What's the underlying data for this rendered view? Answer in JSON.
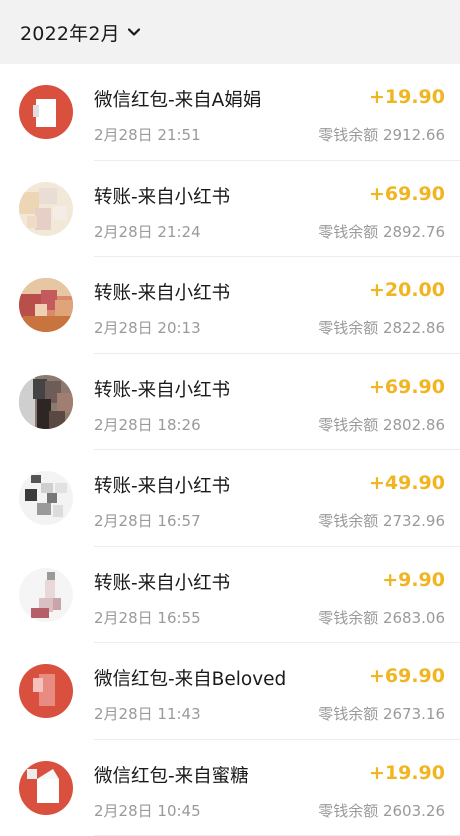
{
  "header": {
    "month": "2022年2月",
    "chevron_icon": "chevron-down-icon"
  },
  "colors": {
    "amount": "#f0b520",
    "secondary_text": "#9a9a9a",
    "background": "#f2f2f2"
  },
  "transactions": [
    {
      "title": "微信红包-来自A娟娟",
      "time": "2月28日 21:51",
      "amount": "+19.90",
      "balance": "零钱余额 2912.66",
      "avatar": "red-packet-avatar"
    },
    {
      "title": "转账-来自小红书",
      "time": "2月28日 21:24",
      "amount": "+69.90",
      "balance": "零钱余额 2892.76",
      "avatar": "blurred-user-avatar"
    },
    {
      "title": "转账-来自小红书",
      "time": "2月28日 20:13",
      "amount": "+20.00",
      "balance": "零钱余额 2822.86",
      "avatar": "blurred-user-avatar"
    },
    {
      "title": "转账-来自小红书",
      "time": "2月28日 18:26",
      "amount": "+69.90",
      "balance": "零钱余额 2802.86",
      "avatar": "blurred-user-avatar"
    },
    {
      "title": "转账-来自小红书",
      "time": "2月28日 16:57",
      "amount": "+49.90",
      "balance": "零钱余额 2732.96",
      "avatar": "blurred-user-avatar"
    },
    {
      "title": "转账-来自小红书",
      "time": "2月28日 16:55",
      "amount": "+9.90",
      "balance": "零钱余额 2683.06",
      "avatar": "blurred-user-avatar"
    },
    {
      "title": "微信红包-来自Beloved",
      "time": "2月28日 11:43",
      "amount": "+69.90",
      "balance": "零钱余额 2673.16",
      "avatar": "red-packet-avatar"
    },
    {
      "title": "微信红包-来自蜜糖",
      "time": "2月28日 10:45",
      "amount": "+19.90",
      "balance": "零钱余额 2603.26",
      "avatar": "red-packet-avatar"
    }
  ]
}
